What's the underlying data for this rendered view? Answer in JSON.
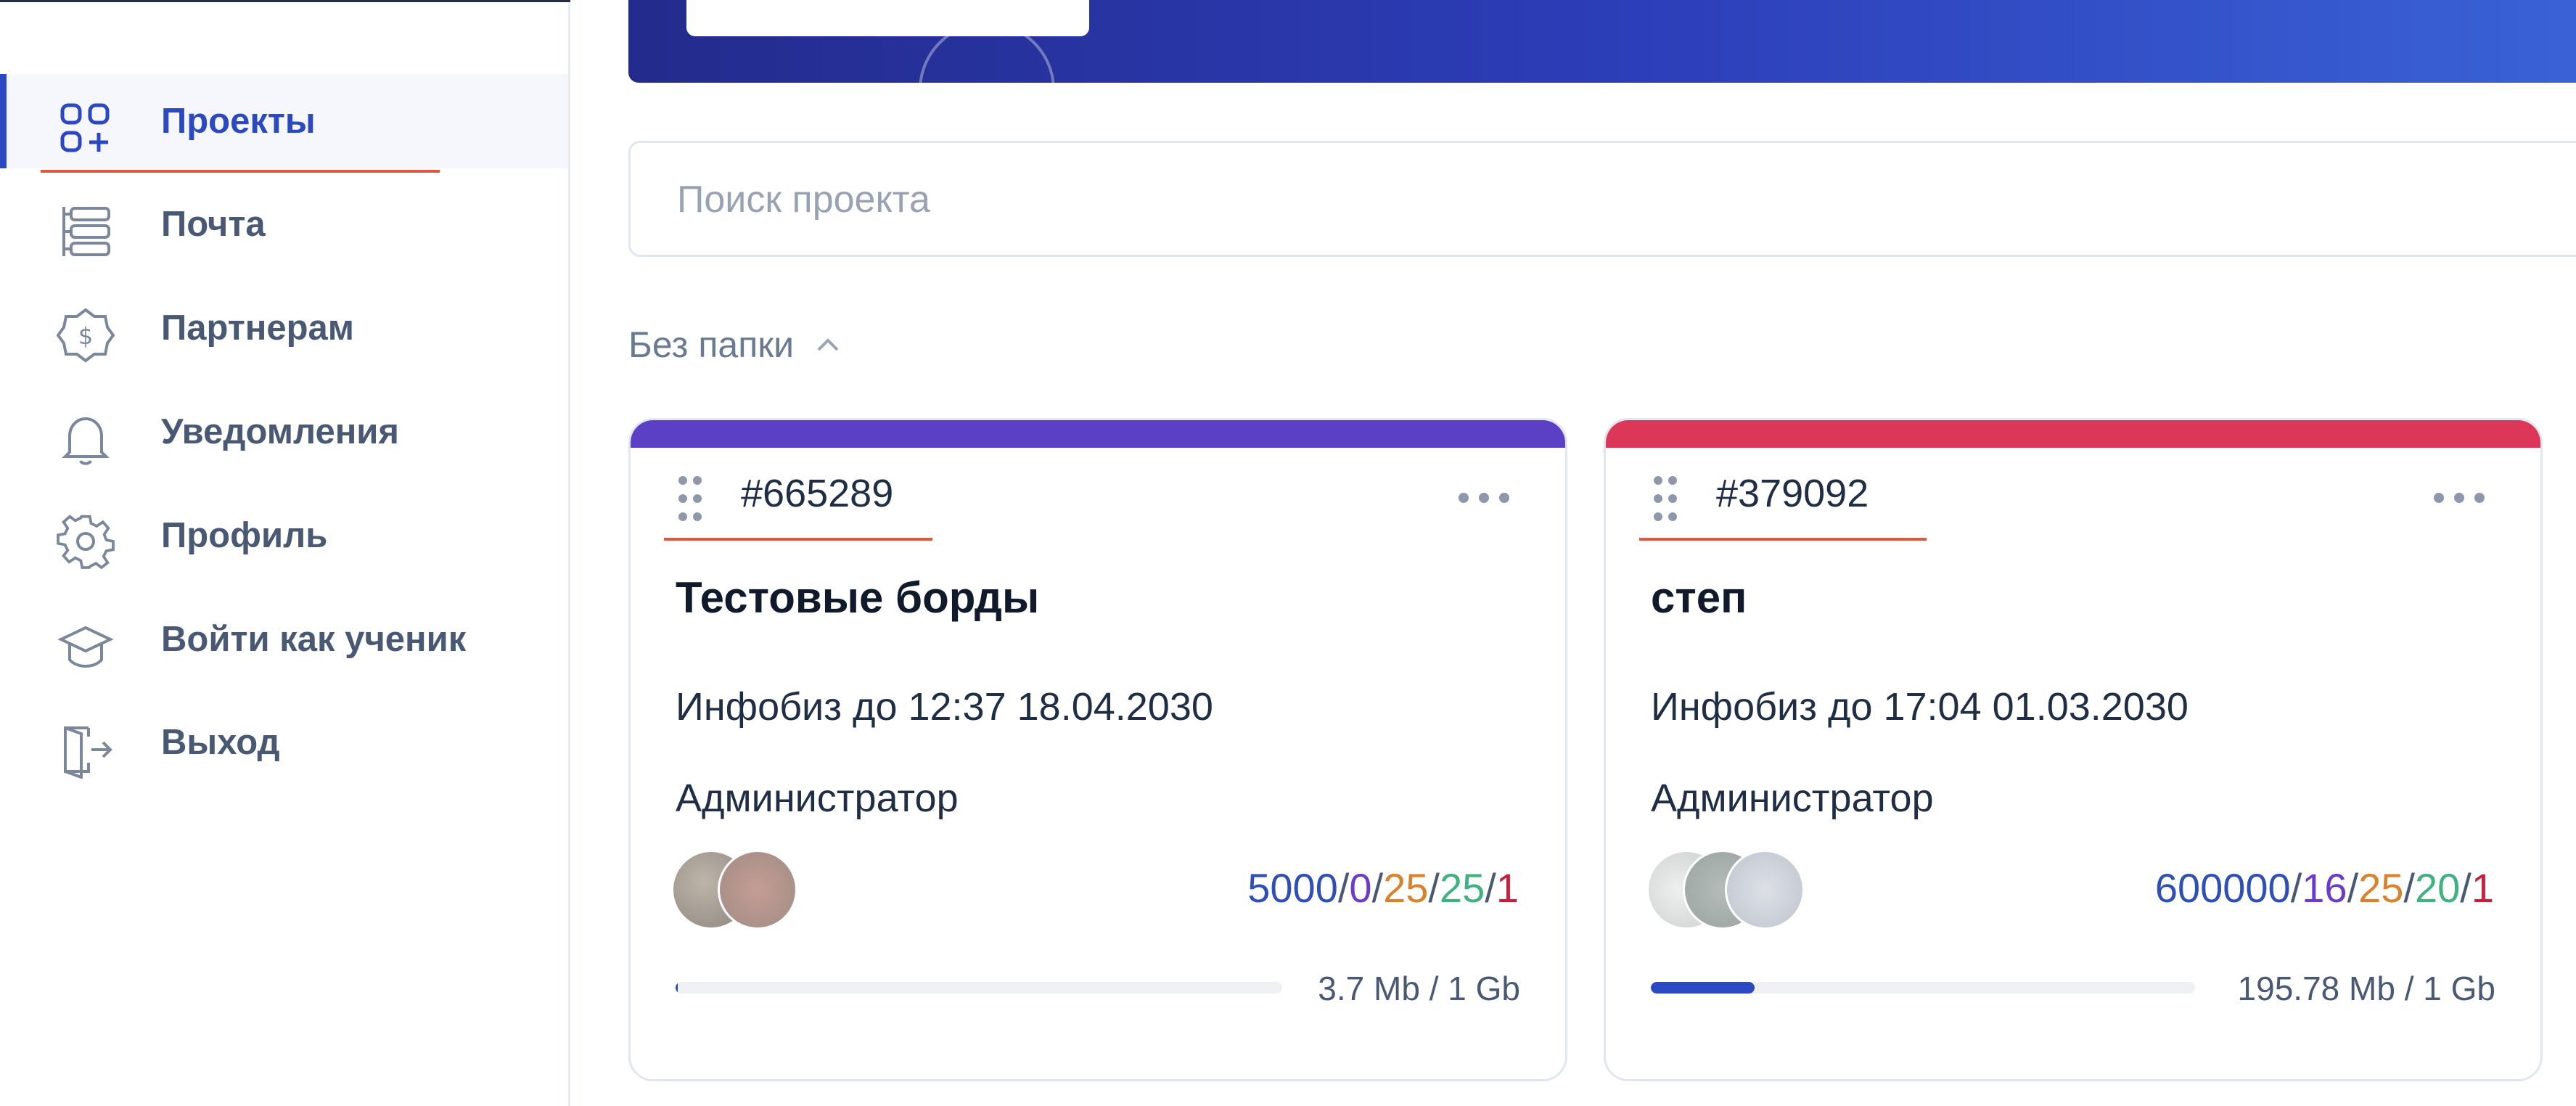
{
  "sidebar": {
    "items": [
      {
        "label": "Проекты",
        "icon": "projects-icon",
        "active": true
      },
      {
        "label": "Почта",
        "icon": "mail-icon"
      },
      {
        "label": "Партнерам",
        "icon": "partners-icon"
      },
      {
        "label": "Уведомления",
        "icon": "bell-icon"
      },
      {
        "label": "Профиль",
        "icon": "gear-icon"
      },
      {
        "label": "Войти как ученик",
        "icon": "student-cap-icon"
      },
      {
        "label": "Выход",
        "icon": "logout-icon"
      }
    ]
  },
  "search": {
    "placeholder": "Поиск проекта",
    "value": ""
  },
  "folder": {
    "label": "Без папки",
    "expanded": true
  },
  "projects": [
    {
      "id": "#665289",
      "name": "Тестовые борды",
      "plan": "Инфобиз до 12:37 18.04.2030",
      "role": "Администратор",
      "accent": "#5b3fc4",
      "stats": {
        "a": "5000",
        "b": "0",
        "c": "25",
        "d": "25",
        "e": "1"
      },
      "storage": "3.7 Mb / 1 Gb",
      "usage_fraction": 0.0036
    },
    {
      "id": "#379092",
      "name": "степ",
      "plan": "Инфобиз до 17:04 01.03.2030",
      "role": "Администратор",
      "accent": "#dc3659",
      "stats": {
        "a": "600000",
        "b": "16",
        "c": "25",
        "d": "20",
        "e": "1"
      },
      "storage": "195.78 Mb / 1 Gb",
      "usage_fraction": 0.19
    }
  ],
  "colors": {
    "brand": "#2b48c2",
    "underline": "#e4553e"
  }
}
